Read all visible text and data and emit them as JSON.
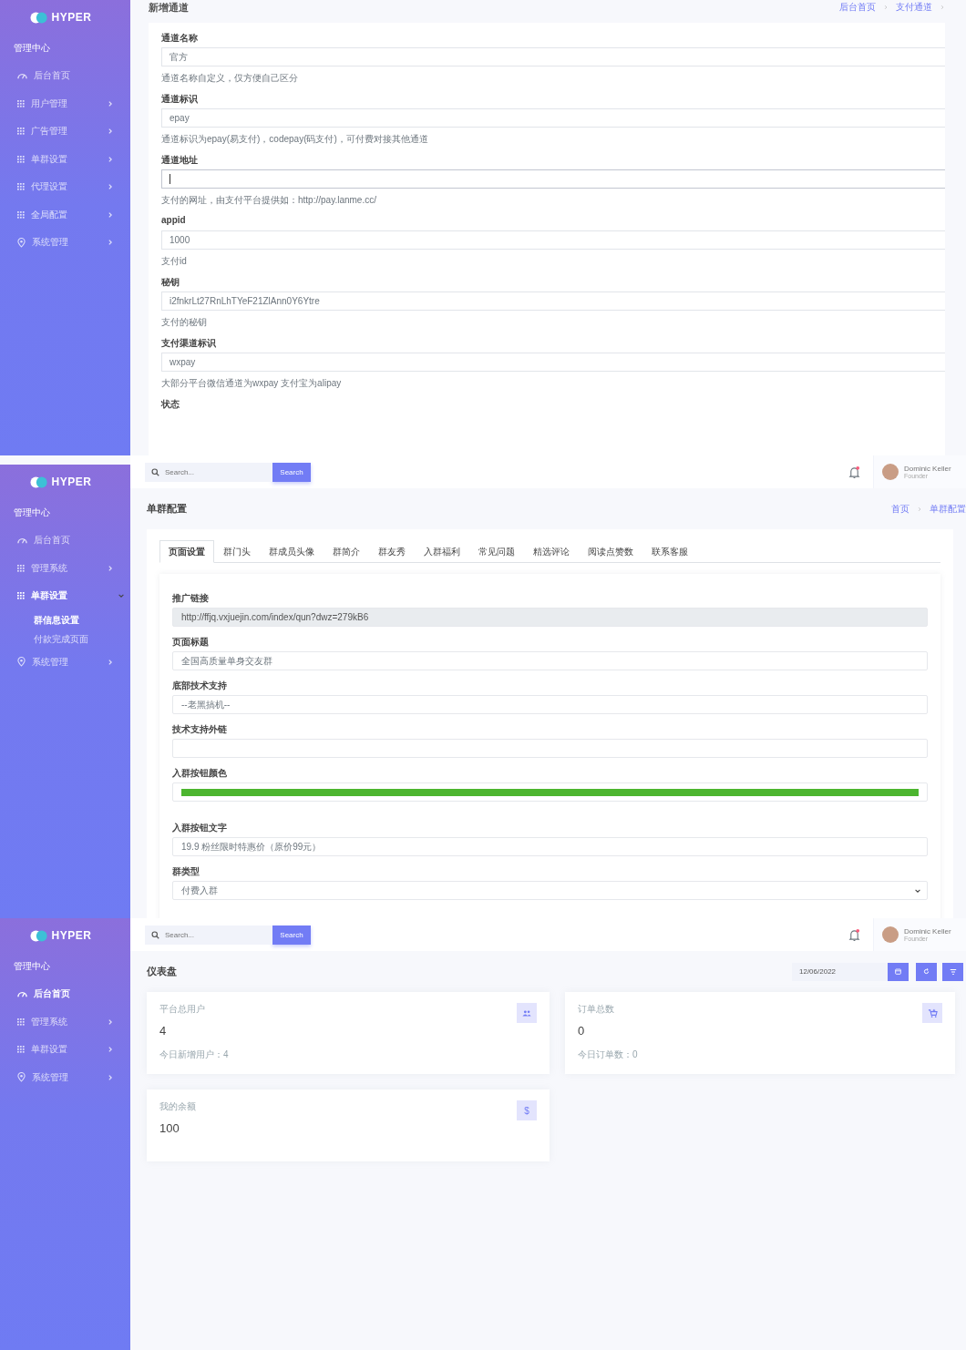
{
  "screens": [
    {
      "kind": "channel_form",
      "sidebar": {
        "brand": "HYPER",
        "section": "管理中心",
        "items": [
          {
            "kind": "dashboard",
            "label": "后台首页",
            "selected": false
          },
          {
            "kind": "group",
            "label": "用户管理",
            "selected": false,
            "expanded": false
          },
          {
            "kind": "group",
            "label": "广告管理",
            "selected": false,
            "expanded": false
          },
          {
            "kind": "group",
            "label": "单群设置",
            "selected": false,
            "expanded": false
          },
          {
            "kind": "group",
            "label": "代理设置",
            "selected": false,
            "expanded": false
          },
          {
            "kind": "group",
            "label": "全局配置",
            "selected": false,
            "expanded": false
          },
          {
            "kind": "system",
            "label": "系统管理",
            "selected": false,
            "expanded": false
          }
        ]
      },
      "title": "新增通道",
      "breadcrumb": [
        "后台首页",
        "支付通道"
      ],
      "trailing_separator": true,
      "fields": [
        {
          "label": "通道名称",
          "value": "官方",
          "help": "通道名称自定义，仅方便自己区分",
          "focused": false
        },
        {
          "label": "通道标识",
          "value": "epay",
          "help": "通道标识为epay(易支付)，codepay(码支付)，可付费对接其他通道",
          "focused": false
        },
        {
          "label": "通道地址",
          "help": "支付的网址，由支付平台提供如：http://pay.lanme.cc/",
          "focused": true
        },
        {
          "label": "appid",
          "value": "1000",
          "help": "支付id",
          "focused": false
        },
        {
          "label": "秘钥",
          "value": "i2fnkrLt27RnLhTYeF21ZlAnn0Y6Ytre",
          "help": "支付的秘钥",
          "focused": false
        },
        {
          "label": "支付渠道标识",
          "value": "wxpay",
          "help": "大部分平台微信通道为wxpay 支付宝为alipay",
          "focused": false
        },
        {
          "label": "状态",
          "focused": false
        }
      ]
    },
    {
      "kind": "group_config",
      "sidebar": {
        "brand": "HYPER",
        "section": "管理中心",
        "items": [
          {
            "kind": "dashboard",
            "label": "后台首页",
            "selected": false
          },
          {
            "kind": "group",
            "label": "管理系统",
            "selected": false,
            "expanded": false
          },
          {
            "kind": "group",
            "label": "单群设置",
            "selected": true,
            "expanded": true,
            "children": [
              {
                "label": "群信息设置",
                "selected": true
              },
              {
                "label": "付款完成页面",
                "selected": false
              }
            ]
          },
          {
            "kind": "system",
            "label": "系统管理",
            "selected": false,
            "expanded": false
          }
        ]
      },
      "topbar": {
        "search_placeholder": "Search...",
        "search_button": "Search",
        "notification": true,
        "user_name": "Dominic Keller",
        "user_role": "Founder"
      },
      "title": "单群配置",
      "breadcrumb": [
        "首页",
        "单群配置"
      ],
      "trailing_separator": false,
      "tabs": [
        {
          "label": "页面设置",
          "selected": true
        },
        {
          "label": "群门头",
          "selected": false
        },
        {
          "label": "群成员头像",
          "selected": false
        },
        {
          "label": "群简介",
          "selected": false
        },
        {
          "label": "群友秀",
          "selected": false
        },
        {
          "label": "入群福利",
          "selected": false
        },
        {
          "label": "常见问题",
          "selected": false
        },
        {
          "label": "精选评论",
          "selected": false
        },
        {
          "label": "阅读点赞数",
          "selected": false
        },
        {
          "label": "联系客服",
          "selected": false
        }
      ],
      "fields": [
        {
          "kind": "text",
          "label": "推广链接",
          "value": "http://ffjq.vxjuejin.com/index/qun?dwz=279kB6",
          "disabled": true
        },
        {
          "kind": "text",
          "label": "页面标题",
          "value": "全国高质量单身交友群",
          "disabled": false
        },
        {
          "kind": "text",
          "label": "底部技术支持",
          "value": "--老黑搞机--",
          "disabled": false
        },
        {
          "kind": "text",
          "label": "技术支持外链",
          "disabled": false
        },
        {
          "kind": "color",
          "label": "入群按钮颜色",
          "color": "#4cb52f",
          "disabled": false
        },
        {
          "kind": "text",
          "label": "入群按钮文字",
          "value": "19.9 粉丝限时特惠价（原价99元）",
          "disabled": false
        },
        {
          "kind": "select",
          "label": "群类型",
          "value": "付费入群",
          "disabled": false
        }
      ]
    },
    {
      "kind": "dashboard",
      "sidebar": {
        "brand": "HYPER",
        "section": "管理中心",
        "items": [
          {
            "kind": "dashboard",
            "label": "后台首页",
            "selected": true
          },
          {
            "kind": "group",
            "label": "管理系统",
            "selected": false,
            "expanded": false
          },
          {
            "kind": "group",
            "label": "单群设置",
            "selected": false,
            "expanded": false
          },
          {
            "kind": "system",
            "label": "系统管理",
            "selected": false,
            "expanded": false
          }
        ]
      },
      "topbar": {
        "search_placeholder": "Search...",
        "search_button": "Search",
        "notification": true,
        "user_name": "Dominic Keller",
        "user_role": "Founder"
      },
      "title": "仪表盘",
      "date": "12/06/2022",
      "stats": [
        {
          "kind": "users",
          "title": "平台总用户",
          "value": "4",
          "sub": "今日新增用户：4"
        },
        {
          "kind": "cart",
          "title": "订单总数",
          "value": "0",
          "sub": "今日订单数：0"
        },
        {
          "kind": "money",
          "title": "我的余额",
          "value": "100",
          "glyph": "$"
        }
      ]
    }
  ]
}
